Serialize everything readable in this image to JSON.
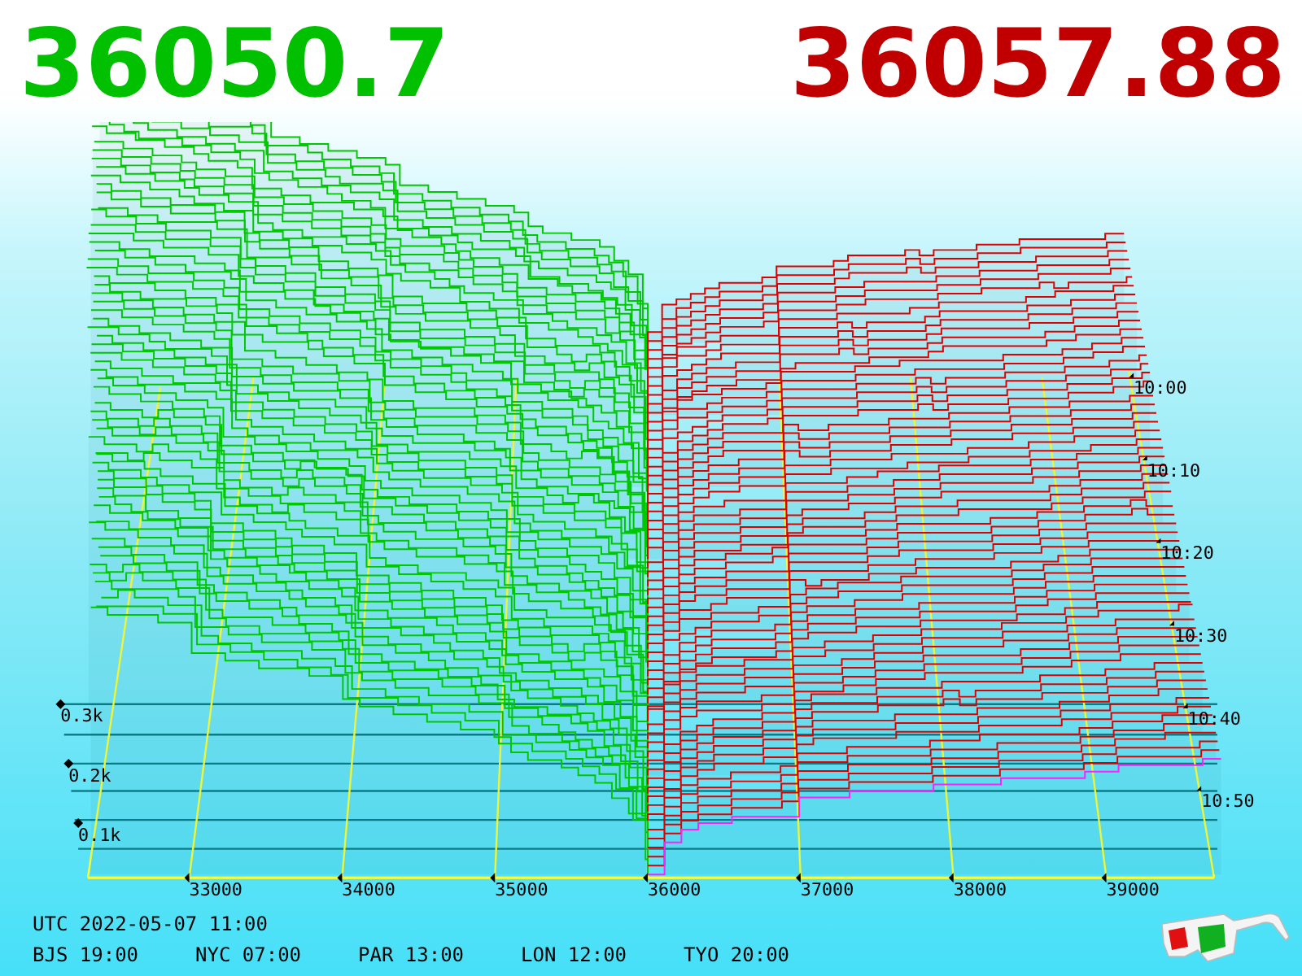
{
  "bid_price": "36050.7",
  "ask_price": "36057.88",
  "chart": {
    "price_ticks": [
      "33000",
      "34000",
      "35000",
      "36000",
      "37000",
      "38000",
      "39000"
    ],
    "depth_ticks": [
      "0.3k",
      "0.2k",
      "0.1k"
    ],
    "time_ticks": [
      "10:00",
      "10:10",
      "10:20",
      "10:30",
      "10:40",
      "10:50"
    ]
  },
  "clock": {
    "utc": "UTC 2022-05-07 11:00",
    "cities": [
      "BJS 19:00",
      "NYC 07:00",
      "PAR 13:00",
      "LON 12:00",
      "TYO 20:00"
    ]
  }
}
